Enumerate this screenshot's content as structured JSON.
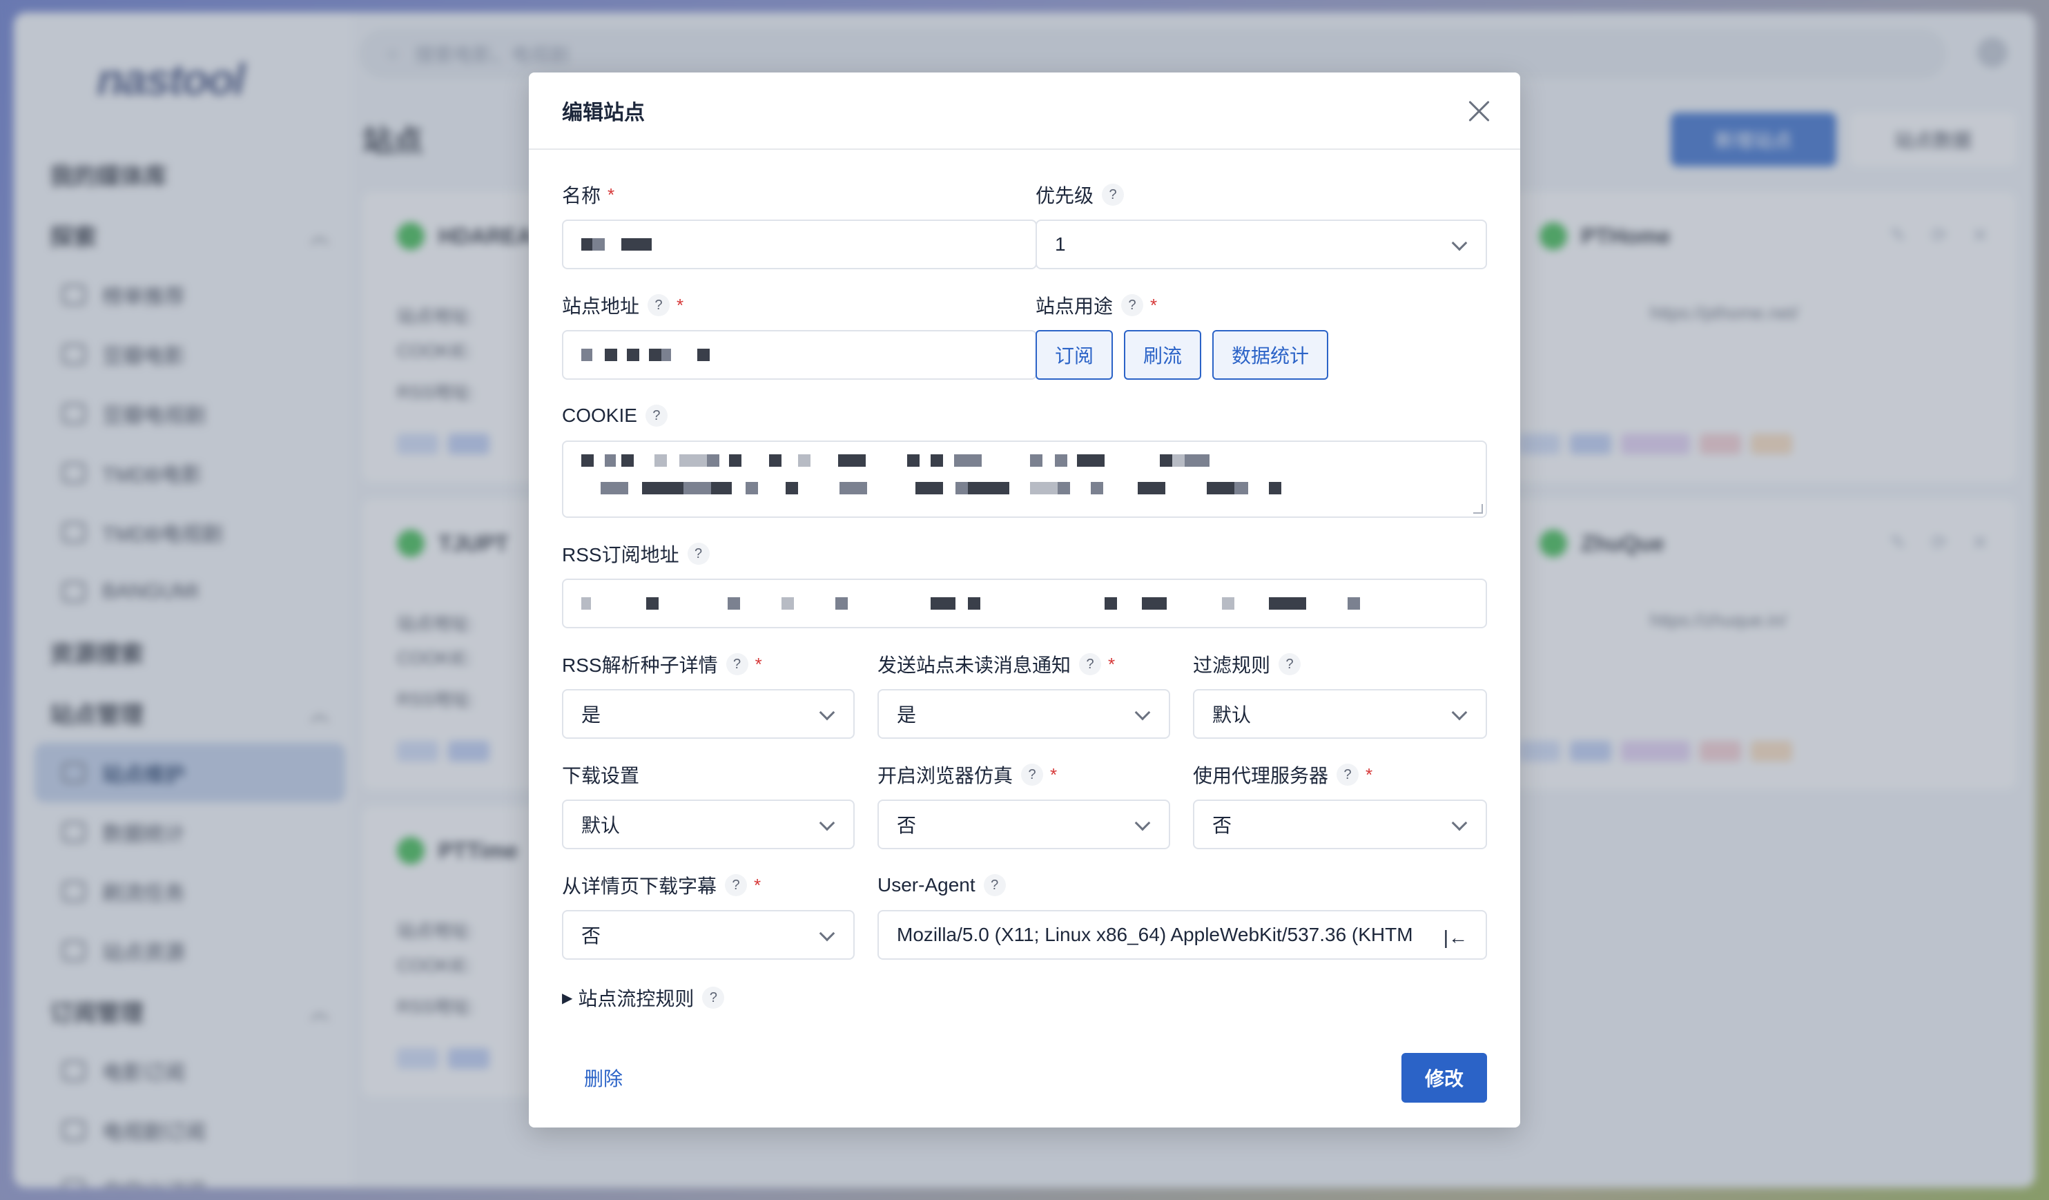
{
  "app": {
    "logo": "nastool",
    "search_placeholder": "搜索电影、电视剧",
    "page_title": "站点",
    "add_site_label": "新增站点",
    "site_data_label": "站点数据",
    "sidebar": {
      "sections": [
        {
          "label": "我的媒体库"
        },
        {
          "label": "探索",
          "items": [
            "榜单推荐",
            "豆瓣电影",
            "豆瓣电视剧",
            "TMDB电影",
            "TMDB电视剧",
            "BANGUMI"
          ]
        },
        {
          "label": "资源搜索"
        },
        {
          "label": "站点管理",
          "items": [
            "站点维护",
            "数据统计",
            "刷流任务",
            "站点资源"
          ]
        },
        {
          "label": "订阅管理",
          "items": [
            "电影订阅",
            "电视剧订阅",
            "自定义订阅"
          ]
        }
      ]
    },
    "cards": [
      {
        "name": "HDAREA",
        "url": ""
      },
      {
        "name": "PTHome",
        "url": "https://pthome.net/"
      },
      {
        "name": "TJUPT",
        "url": ""
      },
      {
        "name": "ZhuQue",
        "url": "https://zhuque.in/"
      },
      {
        "name": "PTTime",
        "url": ""
      }
    ],
    "card_rows": [
      "站点地址:",
      "COOKIE:",
      "RSS地址:"
    ]
  },
  "modal": {
    "title": "编辑站点",
    "fields": {
      "name": {
        "label": "名称"
      },
      "priority": {
        "label": "优先级",
        "value": "1"
      },
      "site_url": {
        "label": "站点地址"
      },
      "usage": {
        "label": "站点用途",
        "options": [
          "订阅",
          "刷流",
          "数据统计"
        ]
      },
      "cookie": {
        "label": "COOKIE"
      },
      "rss_url": {
        "label": "RSS订阅地址"
      },
      "rss_parse": {
        "label": "RSS解析种子详情",
        "value": "是"
      },
      "unread_notify": {
        "label": "发送站点未读消息通知",
        "value": "是"
      },
      "filter_rule": {
        "label": "过滤规则",
        "value": "默认"
      },
      "download_setting": {
        "label": "下载设置",
        "value": "默认"
      },
      "browser_emulation": {
        "label": "开启浏览器仿真",
        "value": "否"
      },
      "proxy": {
        "label": "使用代理服务器",
        "value": "否"
      },
      "subtitle_download": {
        "label": "从详情页下载字幕",
        "value": "否"
      },
      "user_agent": {
        "label": "User-Agent",
        "value": "Mozilla/5.0 (X11; Linux x86_64) AppleWebKit/537.36 (KHTM"
      }
    },
    "flow_rules_label": "站点流控规则",
    "help_glyph": "?",
    "required_glyph": "*",
    "ua_icon_glyph": "|←",
    "delete_label": "删除",
    "submit_label": "修改"
  },
  "colors": {
    "primary": "#2b63c7",
    "required": "#d63939",
    "online_dot": "#2fb344"
  }
}
